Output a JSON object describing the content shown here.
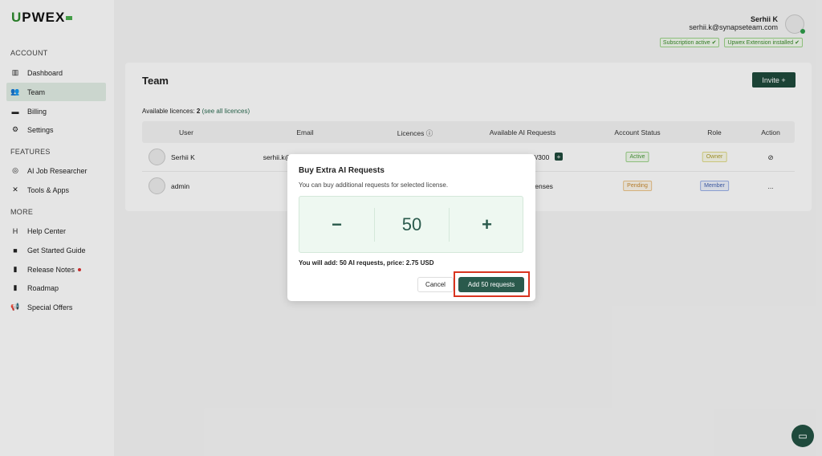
{
  "logo": "UPWEX",
  "sidebar": {
    "sections": [
      "ACCOUNT",
      "FEATURES",
      "MORE"
    ],
    "items": [
      {
        "label": "Dashboard",
        "icon": "chart-icon"
      },
      {
        "label": "Team",
        "icon": "users-icon"
      },
      {
        "label": "Billing",
        "icon": "card-icon"
      },
      {
        "label": "Settings",
        "icon": "gears-icon"
      },
      {
        "label": "AI Job Researcher",
        "icon": "ai-icon"
      },
      {
        "label": "Tools & Apps",
        "icon": "tools-icon"
      },
      {
        "label": "Help Center",
        "icon": "help-icon"
      },
      {
        "label": "Get Started Guide",
        "icon": "video-icon"
      },
      {
        "label": "Release Notes",
        "icon": "book-icon"
      },
      {
        "label": "Roadmap",
        "icon": "map-icon"
      },
      {
        "label": "Special Offers",
        "icon": "megaphone-icon"
      }
    ]
  },
  "user": {
    "name": "Serhii K",
    "email": "serhii.k@synapseteam.com",
    "badges": [
      "Subscription active ✔",
      "Upwex Extension installed ✔"
    ]
  },
  "team": {
    "title": "Team",
    "invite": "Invite +",
    "available_label": "Available licences:",
    "available_count": "2",
    "see_all": "(see all licences)",
    "columns": [
      "User",
      "Email",
      "Licences ⓘ",
      "Available AI Requests",
      "Account Status",
      "Role",
      "Action"
    ],
    "rows": [
      {
        "user": "Serhii K",
        "email": "serhii.k@synapseteam.com",
        "requests": "300/300",
        "status": "Active",
        "role": "Owner",
        "action": "⊘"
      },
      {
        "user": "admin",
        "email": "adm",
        "requests": "No licenses",
        "status": "Pending",
        "role": "Member",
        "action": "..."
      }
    ]
  },
  "modal": {
    "title": "Buy Extra AI Requests",
    "subtitle": "You can buy additional requests for selected license.",
    "minus": "−",
    "value": "50",
    "plus": "+",
    "summary": "You will add: 50 AI requests, price: 2.75 USD",
    "cancel": "Cancel",
    "confirm": "Add 50 requests"
  },
  "colors": {
    "accent": "#2a5a4c",
    "highlight": "#d9341f"
  }
}
